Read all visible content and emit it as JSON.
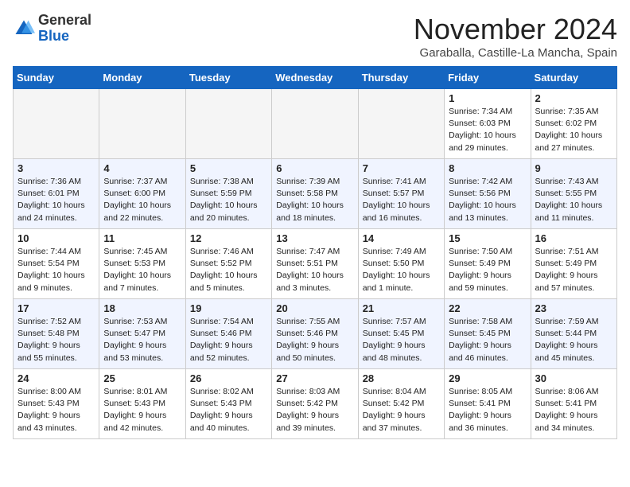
{
  "header": {
    "logo_general": "General",
    "logo_blue": "Blue",
    "month_title": "November 2024",
    "location": "Garaballa, Castille-La Mancha, Spain"
  },
  "weekdays": [
    "Sunday",
    "Monday",
    "Tuesday",
    "Wednesday",
    "Thursday",
    "Friday",
    "Saturday"
  ],
  "weeks": [
    [
      {
        "day": "",
        "info": ""
      },
      {
        "day": "",
        "info": ""
      },
      {
        "day": "",
        "info": ""
      },
      {
        "day": "",
        "info": ""
      },
      {
        "day": "",
        "info": ""
      },
      {
        "day": "1",
        "info": "Sunrise: 7:34 AM\nSunset: 6:03 PM\nDaylight: 10 hours\nand 29 minutes."
      },
      {
        "day": "2",
        "info": "Sunrise: 7:35 AM\nSunset: 6:02 PM\nDaylight: 10 hours\nand 27 minutes."
      }
    ],
    [
      {
        "day": "3",
        "info": "Sunrise: 7:36 AM\nSunset: 6:01 PM\nDaylight: 10 hours\nand 24 minutes."
      },
      {
        "day": "4",
        "info": "Sunrise: 7:37 AM\nSunset: 6:00 PM\nDaylight: 10 hours\nand 22 minutes."
      },
      {
        "day": "5",
        "info": "Sunrise: 7:38 AM\nSunset: 5:59 PM\nDaylight: 10 hours\nand 20 minutes."
      },
      {
        "day": "6",
        "info": "Sunrise: 7:39 AM\nSunset: 5:58 PM\nDaylight: 10 hours\nand 18 minutes."
      },
      {
        "day": "7",
        "info": "Sunrise: 7:41 AM\nSunset: 5:57 PM\nDaylight: 10 hours\nand 16 minutes."
      },
      {
        "day": "8",
        "info": "Sunrise: 7:42 AM\nSunset: 5:56 PM\nDaylight: 10 hours\nand 13 minutes."
      },
      {
        "day": "9",
        "info": "Sunrise: 7:43 AM\nSunset: 5:55 PM\nDaylight: 10 hours\nand 11 minutes."
      }
    ],
    [
      {
        "day": "10",
        "info": "Sunrise: 7:44 AM\nSunset: 5:54 PM\nDaylight: 10 hours\nand 9 minutes."
      },
      {
        "day": "11",
        "info": "Sunrise: 7:45 AM\nSunset: 5:53 PM\nDaylight: 10 hours\nand 7 minutes."
      },
      {
        "day": "12",
        "info": "Sunrise: 7:46 AM\nSunset: 5:52 PM\nDaylight: 10 hours\nand 5 minutes."
      },
      {
        "day": "13",
        "info": "Sunrise: 7:47 AM\nSunset: 5:51 PM\nDaylight: 10 hours\nand 3 minutes."
      },
      {
        "day": "14",
        "info": "Sunrise: 7:49 AM\nSunset: 5:50 PM\nDaylight: 10 hours\nand 1 minute."
      },
      {
        "day": "15",
        "info": "Sunrise: 7:50 AM\nSunset: 5:49 PM\nDaylight: 9 hours\nand 59 minutes."
      },
      {
        "day": "16",
        "info": "Sunrise: 7:51 AM\nSunset: 5:49 PM\nDaylight: 9 hours\nand 57 minutes."
      }
    ],
    [
      {
        "day": "17",
        "info": "Sunrise: 7:52 AM\nSunset: 5:48 PM\nDaylight: 9 hours\nand 55 minutes."
      },
      {
        "day": "18",
        "info": "Sunrise: 7:53 AM\nSunset: 5:47 PM\nDaylight: 9 hours\nand 53 minutes."
      },
      {
        "day": "19",
        "info": "Sunrise: 7:54 AM\nSunset: 5:46 PM\nDaylight: 9 hours\nand 52 minutes."
      },
      {
        "day": "20",
        "info": "Sunrise: 7:55 AM\nSunset: 5:46 PM\nDaylight: 9 hours\nand 50 minutes."
      },
      {
        "day": "21",
        "info": "Sunrise: 7:57 AM\nSunset: 5:45 PM\nDaylight: 9 hours\nand 48 minutes."
      },
      {
        "day": "22",
        "info": "Sunrise: 7:58 AM\nSunset: 5:45 PM\nDaylight: 9 hours\nand 46 minutes."
      },
      {
        "day": "23",
        "info": "Sunrise: 7:59 AM\nSunset: 5:44 PM\nDaylight: 9 hours\nand 45 minutes."
      }
    ],
    [
      {
        "day": "24",
        "info": "Sunrise: 8:00 AM\nSunset: 5:43 PM\nDaylight: 9 hours\nand 43 minutes."
      },
      {
        "day": "25",
        "info": "Sunrise: 8:01 AM\nSunset: 5:43 PM\nDaylight: 9 hours\nand 42 minutes."
      },
      {
        "day": "26",
        "info": "Sunrise: 8:02 AM\nSunset: 5:43 PM\nDaylight: 9 hours\nand 40 minutes."
      },
      {
        "day": "27",
        "info": "Sunrise: 8:03 AM\nSunset: 5:42 PM\nDaylight: 9 hours\nand 39 minutes."
      },
      {
        "day": "28",
        "info": "Sunrise: 8:04 AM\nSunset: 5:42 PM\nDaylight: 9 hours\nand 37 minutes."
      },
      {
        "day": "29",
        "info": "Sunrise: 8:05 AM\nSunset: 5:41 PM\nDaylight: 9 hours\nand 36 minutes."
      },
      {
        "day": "30",
        "info": "Sunrise: 8:06 AM\nSunset: 5:41 PM\nDaylight: 9 hours\nand 34 minutes."
      }
    ]
  ]
}
